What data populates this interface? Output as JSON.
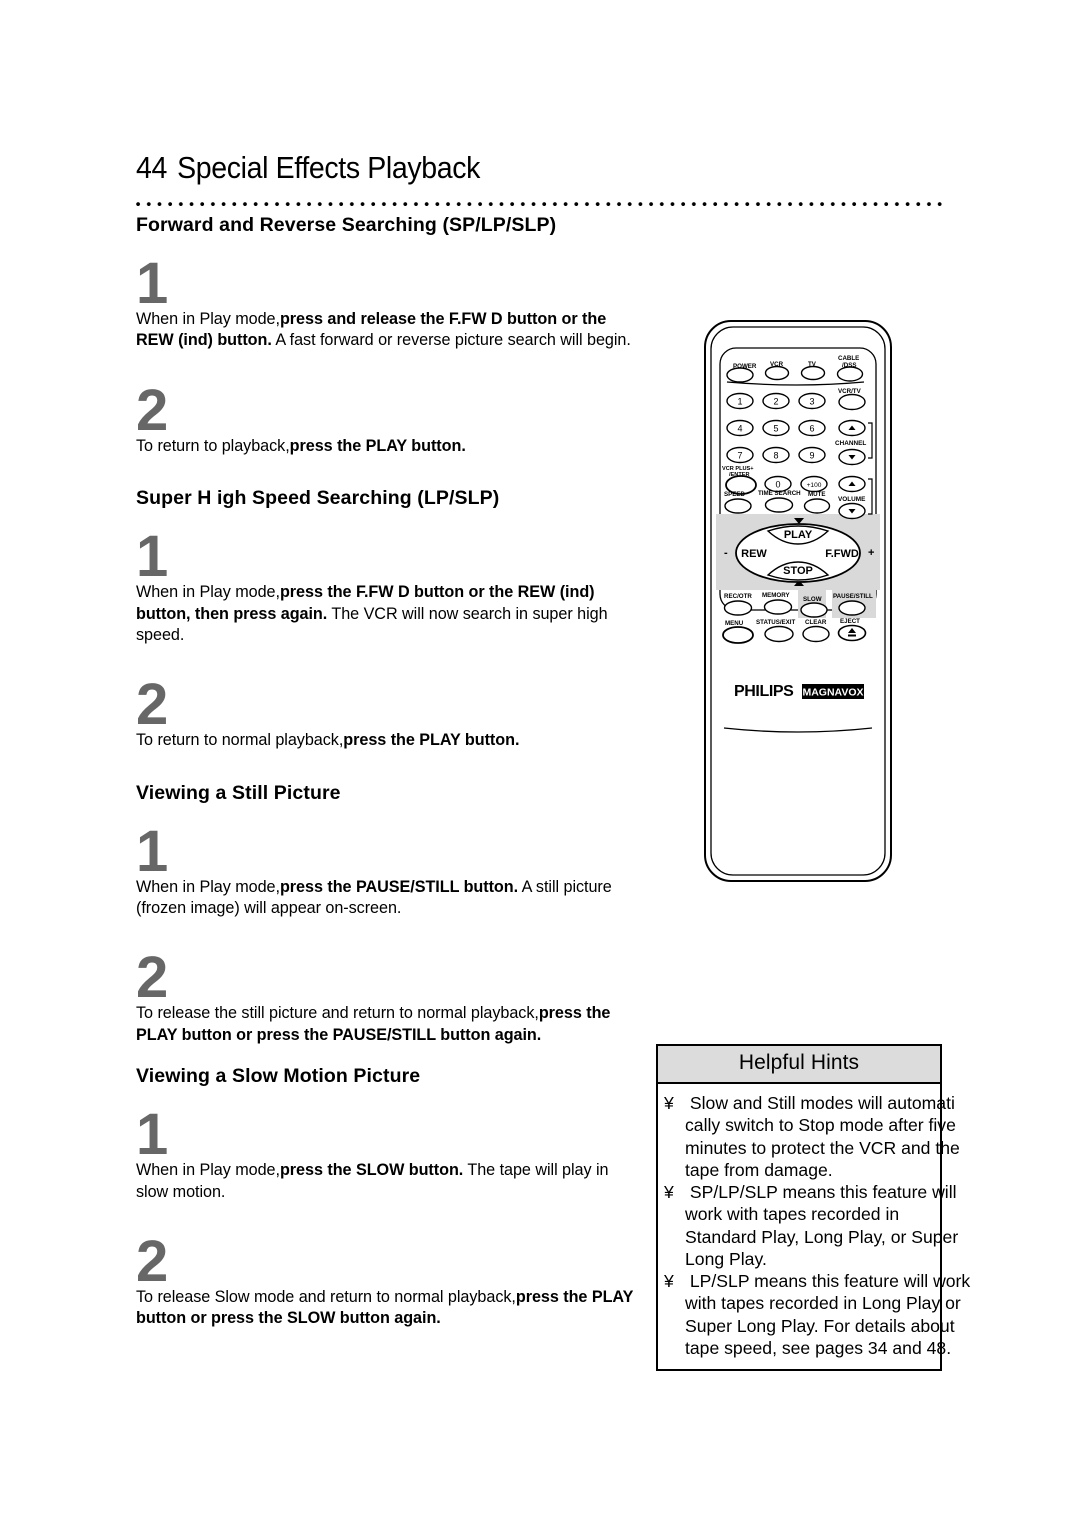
{
  "page": {
    "number": "44",
    "title": "Special Effects Playback"
  },
  "sections": [
    {
      "heading": "Forward and Reverse Searching (SP/LP/SLP)",
      "steps": [
        {
          "number": "1",
          "text_plain_1": "When in Play mode,",
          "text_bold_1": "press and release the F.FW D button or the REW (ind) button.",
          "text_plain_2": " A fast forward or reverse picture search will begin."
        },
        {
          "number": "2",
          "text_plain_1": "To return to playback,",
          "text_bold_1": "press the PLAY button.",
          "text_plain_2": ""
        }
      ]
    },
    {
      "heading": "Super H igh Speed Searching (LP/SLP)",
      "steps": [
        {
          "number": "1",
          "text_plain_1": "When in Play mode,",
          "text_bold_1": "press the F.FW D button or the REW (ind) button, then press again.",
          "text_plain_2": " The VCR will now search in super high speed."
        },
        {
          "number": "2",
          "text_plain_1": "To return to normal playback,",
          "text_bold_1": "press the PLAY button.",
          "text_plain_2": ""
        }
      ]
    },
    {
      "heading": "Viewing a Still Picture",
      "steps": [
        {
          "number": "1",
          "text_plain_1": "When in Play mode,",
          "text_bold_1": "press the PAUSE/STILL button.",
          "text_plain_2": " A still picture (frozen image) will appear on-screen."
        },
        {
          "number": "2",
          "text_plain_1": "To release the still picture and return to normal playback,",
          "text_bold_1": "press the PLAY button or press the PAUSE/STILL button again.",
          "text_plain_2": ""
        }
      ]
    },
    {
      "heading": "Viewing a Slow Motion Picture",
      "steps": [
        {
          "number": "1",
          "text_plain_1": "When in Play mode,",
          "text_bold_1": "press the SLOW  button.",
          "text_plain_2": " The tape will play in slow motion."
        },
        {
          "number": "2",
          "text_plain_1": "To release Slow mode and return to normal playback,",
          "text_bold_1": "press the PLAY button or press the SLOW  button again.",
          "text_plain_2": ""
        }
      ]
    }
  ],
  "hints": {
    "title": "Helpful Hints",
    "bullet": "¥",
    "items": [
      " Slow and Still modes will automati\ncally switch to Stop mode after five\nminutes to protect the VCR and the\ntape from damage.",
      " SP/LP/SLP means this feature will\nwork with tapes recorded in\nStandard Play, Long Play, or Super\nLong Play.",
      " LP/SLP means this feature will work\nwith tapes recorded in Long Play or\nSuper Long Play. For details about\ntape speed, see pages 34 and 48."
    ]
  },
  "remote": {
    "brand_primary": "PHILIPS",
    "brand_secondary": "MAGNAVOX",
    "top_row": [
      "POWER",
      "VCR",
      "TV",
      "CABLE\n/DSS"
    ],
    "keypad": [
      "1",
      "2",
      "3",
      "4",
      "5",
      "6",
      "7",
      "8",
      "9",
      "0",
      "+100"
    ],
    "vcr_plus": "VCR PLUS+\n/ENTER",
    "side_buttons": [
      "VCR/TV",
      "CHANNEL",
      "VOLUME"
    ],
    "function_row": [
      "SPEED",
      "TIME SEARCH",
      "MUTE"
    ],
    "transport": {
      "play": "PLAY",
      "rew": "REW",
      "ffwd": "F.FWD",
      "stop": "STOP",
      "minus": "-",
      "plus": "+"
    },
    "lower_row_1": [
      "REC/OTR",
      "MEMORY",
      "SLOW",
      "PAUSE/STILL"
    ],
    "lower_row_2": [
      "MENU",
      "STATUS/EXIT",
      "CLEAR",
      "EJECT"
    ]
  },
  "colors": {
    "step_number": "#676767",
    "hint_header_bg": "#dcdcdc",
    "remote_shade": "#d9d9d9",
    "ink": "#000000"
  }
}
